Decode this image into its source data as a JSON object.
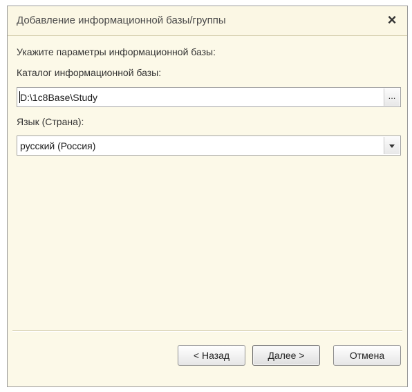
{
  "window": {
    "title": "Добавление информационной базы/группы",
    "close_label": "×"
  },
  "form": {
    "instruction": "Укажите параметры информационной базы:",
    "catalog_label": "Каталог информационной базы:",
    "catalog_value": "D:\\1c8Base\\Study",
    "browse_label": "...",
    "language_label": "Язык (Страна):",
    "language_value": "русский (Россия)"
  },
  "buttons": {
    "back": "< Назад",
    "next": "Далее >",
    "cancel": "Отмена"
  }
}
